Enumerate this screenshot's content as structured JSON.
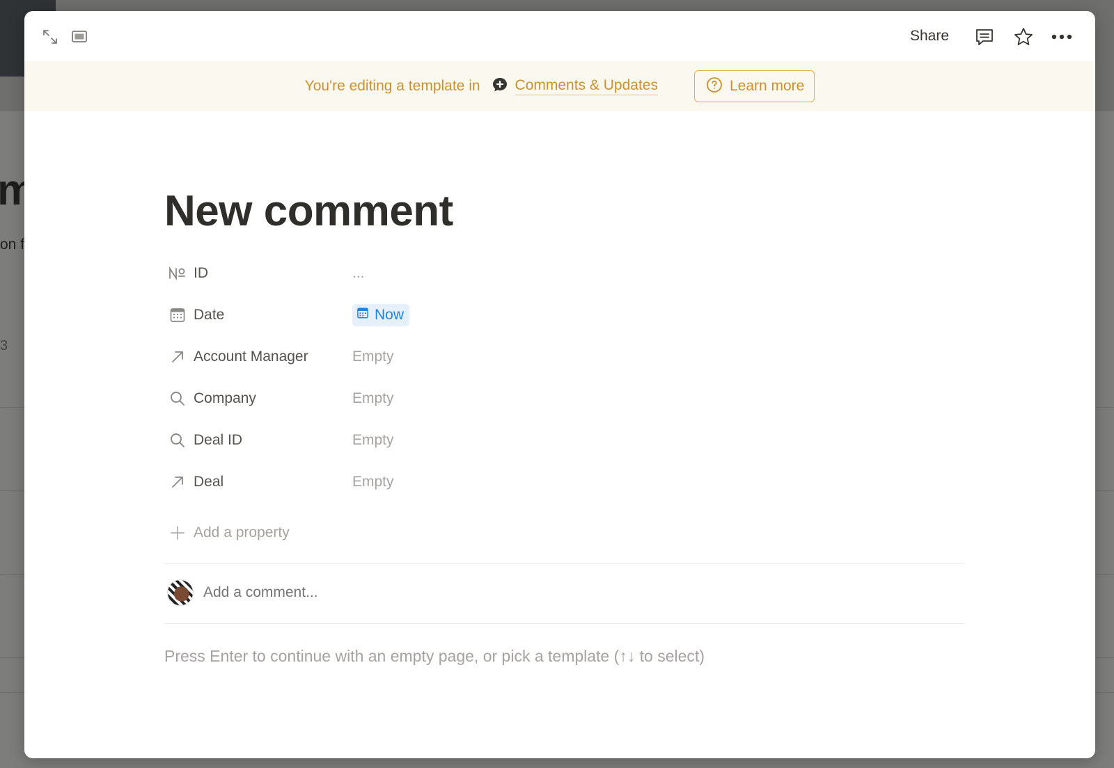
{
  "background": {
    "title_fragment": "m",
    "text_fragment": "on f",
    "num_fragment": "3"
  },
  "topbar": {
    "share_label": "Share",
    "icons": [
      "expand-icon",
      "side-peek-icon",
      "comment-icon",
      "star-icon",
      "more-icon"
    ]
  },
  "banner": {
    "text": "You're editing a template in",
    "database_name": "Comments & Updates",
    "learn_more_label": "Learn more"
  },
  "page": {
    "title": "New comment"
  },
  "properties": [
    {
      "icon": "number-icon",
      "name": "ID",
      "value": "..."
    },
    {
      "icon": "calendar-icon",
      "name": "Date",
      "value": "Now"
    },
    {
      "icon": "relation-arrow-icon",
      "name": "Account Manager",
      "value": "Empty"
    },
    {
      "icon": "rollup-search-icon",
      "name": "Company",
      "value": "Empty"
    },
    {
      "icon": "rollup-search-icon",
      "name": "Deal ID",
      "value": "Empty"
    },
    {
      "icon": "relation-arrow-icon",
      "name": "Deal",
      "value": "Empty"
    }
  ],
  "add_property_label": "Add a property",
  "comment": {
    "placeholder": "Add a comment..."
  },
  "hint": "Press Enter to continue with an empty page, or pick a template (↑↓ to select)",
  "colors": {
    "banner_bg": "#fbf8ef",
    "banner_text": "#cb912f",
    "date_chip_bg": "#e6f0fa",
    "date_chip_text": "#2383e2"
  }
}
